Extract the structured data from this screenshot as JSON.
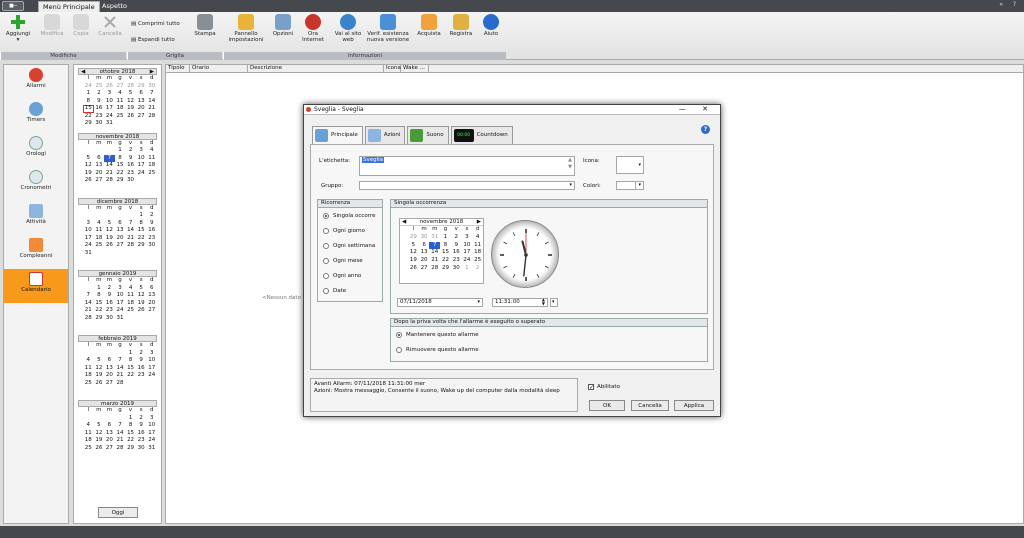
{
  "topbar": {
    "app_button": "■─",
    "tabs": [
      "Menù Principale",
      "Aspetto"
    ],
    "right_controls": "« ?"
  },
  "ribbon": {
    "groups": {
      "modifiche": "Modifiche",
      "griglia": "Griglia",
      "informazioni": "Informazioni"
    },
    "buttons": {
      "aggiungi": "Aggiungi",
      "modifica": "Modifica",
      "copia": "Copia",
      "cancella": "Cancella",
      "comprimi": "Comprimi tutto",
      "espandi": "Espandi tutto",
      "stampa": "Stampa",
      "pannello": "Pannello impostazioni",
      "opzioni": "Opzioni",
      "ora_internet": "Ora Internet",
      "vai_sito": "Vai al sito web",
      "verifica": "Verif. esistenza nuova versione",
      "acquista": "Acquista",
      "registra": "Registra",
      "aiuto": "Aiuto"
    },
    "aggiungi_arrow": "▾"
  },
  "nav": {
    "items": [
      "Allarmi",
      "Timers",
      "Orologi",
      "Cronometri",
      "Attività",
      "Compleanni",
      "Calendario"
    ]
  },
  "calendar": {
    "prev_arrow": "◀",
    "next_arrow": "▶",
    "day_headers": [
      "l",
      "m",
      "m",
      "g",
      "v",
      "s",
      "d"
    ],
    "months": [
      {
        "name": "ottobre 2018",
        "weeks": [
          [
            "40",
            "24",
            "25",
            "26",
            "27",
            "28",
            "29",
            "30"
          ],
          [
            "41",
            "1",
            "2",
            "3",
            "4",
            "5",
            "6",
            "7"
          ],
          [
            "42",
            "8",
            "9",
            "10",
            "11",
            "12",
            "13",
            "14"
          ],
          [
            "43",
            "15",
            "16",
            "17",
            "18",
            "19",
            "20",
            "21"
          ],
          [
            "44",
            "22",
            "23",
            "24",
            "25",
            "26",
            "27",
            "28"
          ],
          [
            "45",
            "29",
            "30",
            "31",
            "",
            "",
            "",
            ""
          ]
        ]
      },
      {
        "name": "novembre 2018",
        "weeks": [
          [
            "44",
            "",
            "",
            "",
            "1",
            "2",
            "3",
            "4"
          ],
          [
            "45",
            "5",
            "6",
            "7",
            "8",
            "9",
            "10",
            "11"
          ],
          [
            "46",
            "12",
            "13",
            "14",
            "15",
            "16",
            "17",
            "18"
          ],
          [
            "47",
            "19",
            "20",
            "21",
            "22",
            "23",
            "24",
            "25"
          ],
          [
            "48",
            "26",
            "27",
            "28",
            "29",
            "30",
            "",
            ""
          ]
        ]
      },
      {
        "name": "dicembre 2018",
        "weeks": [
          [
            "48",
            "",
            "",
            "",
            "",
            "",
            "1",
            "2"
          ],
          [
            "49",
            "3",
            "4",
            "5",
            "6",
            "7",
            "8",
            "9"
          ],
          [
            "50",
            "10",
            "11",
            "12",
            "13",
            "14",
            "15",
            "16"
          ],
          [
            "51",
            "17",
            "18",
            "19",
            "20",
            "21",
            "22",
            "23"
          ],
          [
            "52",
            "24",
            "25",
            "26",
            "27",
            "28",
            "29",
            "30"
          ],
          [
            "1",
            "31",
            "",
            "",
            "",
            "",
            "",
            ""
          ]
        ]
      },
      {
        "name": "gennaio 2019",
        "weeks": [
          [
            "1",
            "",
            "1",
            "2",
            "3",
            "4",
            "5",
            "6"
          ],
          [
            "2",
            "7",
            "8",
            "9",
            "10",
            "11",
            "12",
            "13"
          ],
          [
            "3",
            "14",
            "15",
            "16",
            "17",
            "18",
            "19",
            "20"
          ],
          [
            "4",
            "21",
            "22",
            "23",
            "24",
            "25",
            "26",
            "27"
          ],
          [
            "5",
            "28",
            "29",
            "30",
            "31",
            "",
            "",
            ""
          ]
        ]
      },
      {
        "name": "febbraio 2019",
        "weeks": [
          [
            "5",
            "",
            "",
            "",
            "",
            "1",
            "2",
            "3"
          ],
          [
            "6",
            "4",
            "5",
            "6",
            "7",
            "8",
            "9",
            "10"
          ],
          [
            "7",
            "11",
            "12",
            "13",
            "14",
            "15",
            "16",
            "17"
          ],
          [
            "8",
            "18",
            "19",
            "20",
            "21",
            "22",
            "23",
            "24"
          ],
          [
            "9",
            "25",
            "26",
            "27",
            "28",
            "",
            "",
            ""
          ]
        ]
      },
      {
        "name": "marzo 2019",
        "weeks": [
          [
            "9",
            "",
            "",
            "",
            "",
            "1",
            "2",
            "3"
          ],
          [
            "10",
            "4",
            "5",
            "6",
            "7",
            "8",
            "9",
            "10"
          ],
          [
            "11",
            "11",
            "12",
            "13",
            "14",
            "15",
            "16",
            "17"
          ],
          [
            "12",
            "18",
            "19",
            "20",
            "21",
            "22",
            "23",
            "24"
          ],
          [
            "13",
            "25",
            "26",
            "27",
            "28",
            "29",
            "30",
            "31"
          ]
        ]
      }
    ],
    "today_button": "Oggi"
  },
  "table": {
    "columns": [
      "Tipolo",
      "Orario",
      "Descrizione",
      "Icona",
      "Wake ..."
    ],
    "empty_text": "<Nessun dato d"
  },
  "dialog": {
    "title": "Sveglia - Sveglia",
    "title_buttons": "— ✕",
    "tabs": [
      "Principale",
      "Azioni",
      "Suono",
      "Countdown"
    ],
    "countdown_display": "00:00",
    "help": "?",
    "etichetta_label": "L'etichetta:",
    "etichetta_value": "Sveglia",
    "gruppo_label": "Gruppo:",
    "icona_label": "Icona:",
    "colori_label": "Colori:",
    "ricorrenza": {
      "title": "Ricorrenza",
      "options": [
        "Singola occorre",
        "Ogni giorno",
        "Ogni settimana",
        "Ogni mese",
        "Ogni anno",
        "Date"
      ],
      "selected": 0
    },
    "singola": {
      "title": "Singola occorrenza",
      "month": "novembre 2018",
      "weeks": [
        [
          "44",
          "29",
          "30",
          "31",
          "1",
          "2",
          "3",
          "4"
        ],
        [
          "45",
          "5",
          "6",
          "7",
          "8",
          "9",
          "10",
          "11"
        ],
        [
          "46",
          "12",
          "13",
          "14",
          "15",
          "16",
          "17",
          "18"
        ],
        [
          "47",
          "19",
          "20",
          "21",
          "22",
          "23",
          "24",
          "25"
        ],
        [
          "48",
          "26",
          "27",
          "28",
          "29",
          "30",
          "1",
          "2"
        ]
      ],
      "date_value": "07/11/2018",
      "time_value": "11:31:00",
      "clock_time": "11:31:00"
    },
    "dopo": {
      "title": "Dopo la priva volta che l'allarme è eseguito o superato",
      "options": [
        "Mantenere questo allarme",
        "Rimuovere questo allarme"
      ],
      "selected": 0
    },
    "info_line1": "Avanti Allarm: 07/11/2018 11:31:00 mer",
    "info_line2": "Azioni: Mostra messaggio, Consente il suono, Wake up del computer dalla modalità sleep",
    "abilitato": "Abilitato",
    "ok": "OK",
    "cancella": "Cancella",
    "applica": "Applica"
  },
  "colors": {
    "accent": "#f79a1c",
    "selection": "#2b5fcf",
    "dark_bar": "#45484c"
  }
}
